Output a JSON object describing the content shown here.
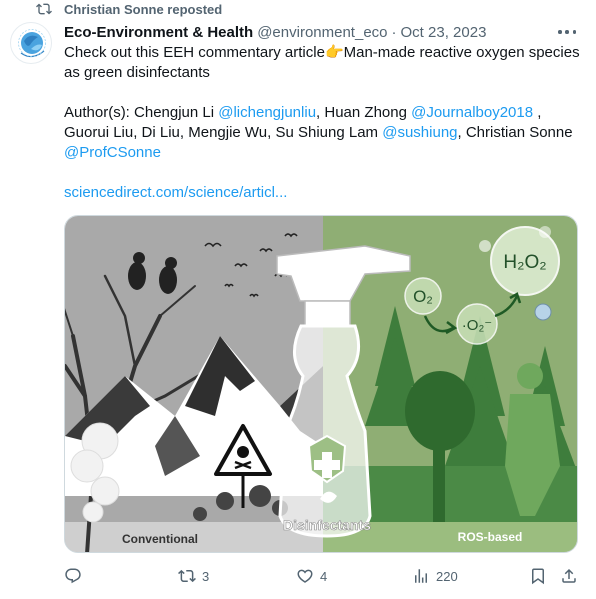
{
  "repost": {
    "label": "Christian Sonne reposted"
  },
  "author": {
    "name": "Eco-Environment & Health",
    "handle": "@environment_eco",
    "separator": "·",
    "date": "Oct 23, 2023"
  },
  "post": {
    "line1_prefix": "Check out this EEH commentary article",
    "emoji": "👉",
    "line1_suffix": "Man-made reactive oxygen species as green disinfectants",
    "authors_label": "Author(s): Chengjun Li ",
    "mention1": "@lichengjunliu",
    "t1": ", Huan Zhong ",
    "mention2": "@Journalboy2018",
    "t2": " , Guorui Liu, Di Liu, Mengjie Wu, Su Shiung Lam ",
    "mention3": "@sushiung",
    "t3": ", Christian Sonne ",
    "mention4": "@ProfCSonne",
    "link": "sciencedirect.com/science/articl..."
  },
  "media": {
    "left_label": "Conventional",
    "right_label": "ROS-based",
    "bottle_label": "Disinfectants",
    "chem_o2": "O₂",
    "chem_superoxide": "·O₂⁻",
    "chem_h2o2": "H₂O₂"
  },
  "actions": {
    "reply_count": "",
    "repost_count": "3",
    "like_count": "4",
    "views_count": "220"
  },
  "colors": {
    "accent": "#1d9bf0",
    "muted": "#536471"
  }
}
